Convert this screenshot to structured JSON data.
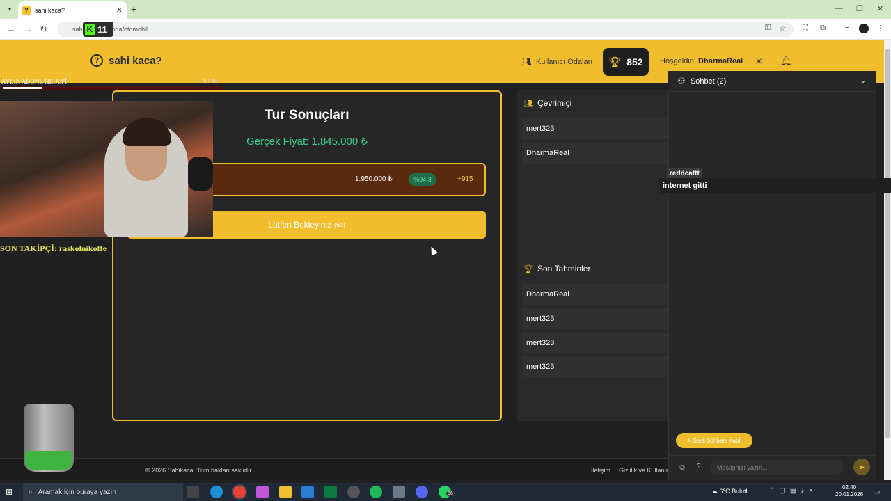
{
  "browser": {
    "tab_title": "sahi kaca?",
    "tab_favicon": "?",
    "url_prefix": "sahi",
    "url_suffix": "oda/otomobil"
  },
  "header": {
    "logo": "sahi kaca?",
    "rooms_label": "Kullanıcı Odaları",
    "score": "852",
    "welcome_prefix": "Hoşgeldin, ",
    "username": "DharmaReal"
  },
  "results": {
    "title": "Tur Sonuçları",
    "real_price": "Gerçek Fiyat: 1.845.000 ₺",
    "guess_value": "1.950.000 ₺",
    "guess_accuracy": "%94.3",
    "guess_points": "+915",
    "wait_label": "Lütfen Bekleyiniz",
    "wait_timer": "(6s)"
  },
  "online": {
    "title": "Çevrimiçi",
    "users": [
      "mert323",
      "DharmaReal"
    ]
  },
  "recent": {
    "title": "Son Tahminler",
    "users": [
      "DharmaReal",
      "mert323",
      "mert323",
      "mert323"
    ]
  },
  "chat": {
    "title": "Sohbet (2)",
    "voice_label": "Sesli Sohbete Katıl",
    "input_placeholder": "Mesajınızı yazın...",
    "help": "?"
  },
  "footer": {
    "copyright": "© 2026 Sahikaca. Tüm hakları saklıdır.",
    "contact": "İletişim",
    "privacy": "Gizlilik ve Kullanım"
  },
  "overlay": {
    "sub_goal": "AYLIK ABONE HEDEFİ",
    "goal_count": "8 / 45",
    "goal_progress": 0.18,
    "last_follower": "SON TAKİPÇİ: raskolnikoffe",
    "kick_count": "11",
    "chat_user": "reddcattt",
    "chat_message": "internet gitti"
  },
  "taskbar": {
    "search_placeholder": "Aramak için buraya yazın",
    "weather": "6°C  Bulutlu",
    "time": "02:40",
    "date": "20.01.2026",
    "whatsapp_badge": "56"
  },
  "colors": {
    "accent": "#f0bd2c",
    "success": "#3ecf8e",
    "background": "#202020"
  }
}
